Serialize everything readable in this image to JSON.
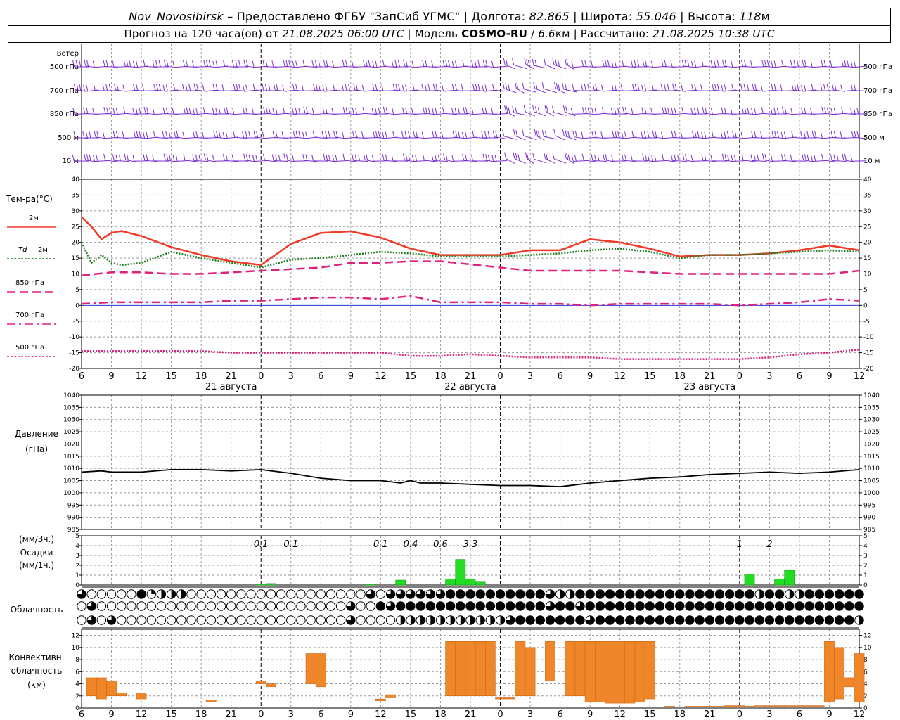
{
  "header": {
    "station": "Nov_Novosibirsk",
    "dash": "–",
    "provider": "Предоставлено ФГБУ \"ЗапСиб УГМС\"",
    "lon_label": "Долгота:",
    "lon": "82.865",
    "lat_label": "Широта:",
    "lat": "55.046",
    "alt_label": "Высота:",
    "alt": "118",
    "alt_unit": "м",
    "forecast_prefix": "Прогноз на 120 часа(ов) от",
    "forecast_start": "21.08.2025 06:00 UTC",
    "model_label": "Модель",
    "model": "COSMO-RU",
    "resolution": "6.6",
    "res_unit": "км",
    "calc_label": "Рассчитано:",
    "calc_time": "21.08.2025 10:38 UTC",
    "sep": "|"
  },
  "wind": {
    "title": "Ветер",
    "levels": [
      "500 гПа",
      "700 гПа",
      "850 гПа",
      "500 м",
      "10  м"
    ],
    "color": "#7b2fd0"
  },
  "temperature": {
    "title": "Тем-ра(°C)",
    "legend": [
      {
        "label": "2м",
        "color": "#f03a2a",
        "style": "solid"
      },
      {
        "label": "Td",
        "label2": "2м",
        "color": "#1e7d1e",
        "style": "dotted"
      },
      {
        "label": "850 гПа",
        "color": "#e0207a",
        "style": "dashed"
      },
      {
        "label": "700 гПа",
        "color": "#e0207a",
        "style": "dashdot"
      },
      {
        "label": "500 гПа",
        "color": "#e0207a",
        "style": "dotted"
      }
    ]
  },
  "pressure": {
    "title": "Давление",
    "unit": "(гПа)"
  },
  "precip": {
    "unit3": "(мм/3ч.)",
    "title": "Осадки",
    "unit1": "(мм/1ч.)",
    "color": "#22dd22",
    "annotations": [
      {
        "h": 24,
        "text": "0.1"
      },
      {
        "h": 27,
        "text": "0.1"
      },
      {
        "h": 36,
        "text": "0.1"
      },
      {
        "h": 39,
        "text": "0.4"
      },
      {
        "h": 42,
        "text": "0.6"
      },
      {
        "h": 45,
        "text": "3.3"
      },
      {
        "h": 72,
        "text": "1"
      },
      {
        "h": 75,
        "text": "2"
      }
    ]
  },
  "cloud": {
    "title": "Облачность"
  },
  "conv": {
    "title1": "Конвективн.",
    "title2": "облачность",
    "unit": "(км)",
    "color": "#f0862a"
  },
  "axis": {
    "day_labels": [
      {
        "h": 6,
        "text": "21 августа"
      },
      {
        "h": 30,
        "text": "22 августа"
      },
      {
        "h": 54,
        "text": "23 августа"
      }
    ]
  },
  "chart_data": {
    "type": "line",
    "x_unit": "hours since 21.08.2025 00 UTC",
    "x_range": [
      6,
      84
    ],
    "x_ticks": [
      6,
      9,
      12,
      15,
      18,
      21,
      0,
      3,
      6,
      9,
      12,
      15,
      18,
      21,
      0,
      3,
      6,
      9,
      12,
      15,
      18,
      21,
      0,
      3,
      6,
      9,
      12
    ],
    "midnight_hours": [
      24,
      48,
      72
    ],
    "temperature": {
      "ylim": [
        -20,
        40
      ],
      "yticks": [
        -20,
        -15,
        -10,
        -5,
        0,
        5,
        10,
        15,
        20,
        25,
        30,
        35,
        40
      ],
      "series": [
        {
          "name": "2м",
          "x": [
            6,
            7,
            8,
            9,
            10,
            12,
            15,
            18,
            21,
            24,
            27,
            30,
            33,
            36,
            39,
            42,
            45,
            48,
            51,
            54,
            57,
            60,
            63,
            66,
            69,
            72,
            75,
            78,
            81,
            84
          ],
          "values": [
            28,
            25,
            21,
            23,
            23.6,
            22,
            18.5,
            16,
            14,
            12.8,
            19.5,
            23,
            23.5,
            21.5,
            18,
            16,
            16,
            16,
            17.5,
            17.5,
            21,
            20,
            18,
            15.5,
            16,
            16,
            16.5,
            17.5,
            19,
            17.5
          ]
        },
        {
          "name": "Td 2м",
          "x": [
            6,
            7,
            8,
            9,
            10,
            12,
            15,
            18,
            21,
            24,
            27,
            30,
            33,
            36,
            39,
            42,
            45,
            48,
            51,
            54,
            57,
            60,
            63,
            66,
            69,
            72,
            75,
            78,
            81,
            84
          ],
          "values": [
            20,
            13.5,
            16,
            13.5,
            12.8,
            13.5,
            17,
            15,
            13.5,
            12,
            14.5,
            15,
            16,
            17,
            16.5,
            15.5,
            15.5,
            15.5,
            16,
            16.5,
            17.5,
            18,
            17,
            15,
            16,
            16,
            16.5,
            17,
            17.5,
            17
          ]
        },
        {
          "name": "850 гПа",
          "x": [
            6,
            9,
            12,
            15,
            18,
            21,
            24,
            27,
            30,
            33,
            36,
            39,
            42,
            45,
            48,
            51,
            54,
            57,
            60,
            63,
            66,
            69,
            72,
            75,
            78,
            81,
            84
          ],
          "values": [
            9.5,
            10.5,
            10.5,
            10,
            10,
            10.5,
            11,
            11.5,
            12,
            13.5,
            13.5,
            14,
            14,
            13,
            12,
            11,
            11,
            11,
            11,
            10.5,
            10,
            10,
            10,
            10,
            10,
            10,
            11
          ]
        },
        {
          "name": "700 гПа",
          "x": [
            6,
            9,
            12,
            15,
            18,
            21,
            24,
            27,
            30,
            33,
            36,
            39,
            42,
            45,
            48,
            51,
            54,
            57,
            60,
            63,
            66,
            69,
            72,
            75,
            78,
            81,
            84
          ],
          "values": [
            0.5,
            1,
            1,
            1,
            1,
            1.5,
            1.5,
            2,
            2.5,
            2.5,
            2,
            3,
            1,
            1,
            1,
            0.5,
            0.5,
            0,
            0.5,
            0.5,
            0.5,
            0.5,
            0,
            0.5,
            1,
            2,
            1.5
          ]
        },
        {
          "name": "500 гПа",
          "x": [
            6,
            9,
            12,
            15,
            18,
            21,
            24,
            27,
            30,
            33,
            36,
            39,
            42,
            45,
            48,
            51,
            54,
            57,
            60,
            63,
            66,
            69,
            72,
            75,
            78,
            81,
            84
          ],
          "values": [
            -14.5,
            -14.5,
            -14.5,
            -14.5,
            -14.5,
            -15,
            -15,
            -15,
            -15,
            -15,
            -15,
            -16,
            -16,
            -15.5,
            -16,
            -16.5,
            -16.5,
            -16.5,
            -17,
            -17,
            -17,
            -17,
            -17,
            -16.5,
            -15.5,
            -15,
            -14
          ]
        }
      ]
    },
    "pressure": {
      "ylim": [
        985,
        1040
      ],
      "yticks": [
        985,
        990,
        995,
        1000,
        1005,
        1010,
        1015,
        1020,
        1025,
        1030,
        1035,
        1040
      ],
      "x": [
        6,
        8,
        9,
        12,
        15,
        18,
        21,
        24,
        27,
        30,
        33,
        36,
        38,
        39,
        40,
        42,
        45,
        48,
        51,
        54,
        57,
        60,
        63,
        66,
        69,
        72,
        75,
        78,
        81,
        84
      ],
      "values": [
        1008.5,
        1009,
        1008.5,
        1008.5,
        1009.5,
        1009.5,
        1009,
        1009.5,
        1008,
        1006,
        1005,
        1005,
        1004,
        1005,
        1004,
        1004,
        1003.5,
        1003,
        1003,
        1002.5,
        1004,
        1005,
        1006,
        1006.5,
        1007.5,
        1008,
        1008.5,
        1008,
        1008.5,
        1009.5
      ]
    },
    "precipitation": {
      "ylim": [
        0,
        5
      ],
      "yticks": [
        0,
        1,
        2,
        3,
        4,
        5
      ],
      "x": [
        24,
        25,
        35,
        38,
        43,
        44,
        45,
        46,
        73,
        76,
        77
      ],
      "values": [
        0.1,
        0.15,
        0.1,
        0.5,
        0.6,
        2.6,
        0.6,
        0.3,
        1.1,
        0.6,
        1.5
      ]
    },
    "cloudiness": {
      "rows": [
        "верхний ярус",
        "средний ярус",
        "нижний ярус"
      ],
      "scale": "0=ясно, 1=четверть, 2=половина, 3=три четверти, 4=сплошная",
      "hours": [
        6,
        7,
        8,
        9,
        10,
        11,
        12,
        13,
        14,
        15,
        16,
        17,
        18,
        19,
        20,
        21,
        22,
        23,
        24,
        25,
        26,
        27,
        28,
        29,
        30,
        31,
        32,
        33,
        34,
        35,
        36,
        37,
        38,
        39,
        40,
        41,
        42,
        43,
        44,
        45,
        46,
        47,
        48,
        49,
        50,
        51,
        52,
        53,
        54,
        55,
        56,
        57,
        58,
        59,
        60,
        61,
        62,
        63,
        64,
        65,
        66,
        67,
        68,
        69,
        70,
        71,
        72,
        73,
        74,
        75,
        76,
        77,
        78,
        79,
        80,
        81,
        82,
        83,
        84
      ],
      "top": [
        3,
        0,
        0,
        0,
        0,
        0,
        4,
        1,
        2,
        2,
        2,
        0,
        0,
        0,
        0,
        0,
        0,
        0,
        0,
        0,
        0,
        0,
        0,
        0,
        0,
        0,
        0,
        0,
        0,
        3,
        0,
        3,
        3,
        3,
        3,
        3,
        3,
        4,
        4,
        4,
        4,
        4,
        4,
        4,
        4,
        4,
        4,
        3,
        2,
        2,
        4,
        4,
        4,
        4,
        4,
        4,
        4,
        4,
        4,
        4,
        4,
        4,
        4,
        4,
        4,
        4,
        4,
        4,
        2,
        4,
        4,
        2,
        2,
        4,
        4,
        4,
        4,
        4,
        4
      ],
      "middle": [
        0,
        3,
        0,
        0,
        0,
        0,
        0,
        0,
        0,
        0,
        0,
        0,
        0,
        0,
        0,
        0,
        0,
        0,
        0,
        0,
        0,
        0,
        0,
        0,
        0,
        0,
        0,
        3,
        0,
        0,
        4,
        3,
        4,
        4,
        4,
        4,
        4,
        4,
        4,
        4,
        4,
        4,
        4,
        4,
        4,
        4,
        4,
        3,
        4,
        4,
        3,
        4,
        4,
        4,
        4,
        4,
        4,
        4,
        4,
        4,
        4,
        4,
        4,
        4,
        4,
        4,
        4,
        4,
        4,
        4,
        4,
        4,
        4,
        4,
        4,
        4,
        4,
        4,
        4
      ],
      "bottom": [
        0,
        3,
        0,
        3,
        0,
        0,
        0,
        0,
        0,
        0,
        0,
        0,
        0,
        0,
        0,
        0,
        0,
        0,
        0,
        0,
        0,
        0,
        0,
        0,
        0,
        0,
        0,
        3,
        0,
        0,
        0,
        0,
        2,
        2,
        2,
        2,
        2,
        2,
        2,
        2,
        2,
        2,
        2,
        3,
        4,
        4,
        4,
        4,
        4,
        4,
        4,
        3,
        4,
        4,
        4,
        4,
        4,
        4,
        4,
        4,
        4,
        4,
        4,
        4,
        4,
        4,
        4,
        4,
        4,
        4,
        4,
        4,
        4,
        4,
        4,
        4,
        4,
        4,
        2
      ]
    },
    "convective_cloud": {
      "ylim": [
        0,
        13
      ],
      "yticks": [
        0,
        2,
        4,
        6,
        8,
        10,
        12
      ],
      "x": [
        7,
        8,
        9,
        10,
        12,
        19,
        24,
        25,
        29,
        30,
        36,
        37,
        43,
        44,
        45,
        46,
        47,
        48,
        49,
        50,
        51,
        53,
        55,
        56,
        57,
        58,
        59,
        60,
        61,
        62,
        63,
        65,
        67,
        68,
        69,
        70,
        71,
        72,
        73,
        74,
        75,
        76,
        77,
        78,
        79,
        80,
        81,
        82,
        83,
        84
      ],
      "base": [
        2,
        1.5,
        2,
        2,
        1.5,
        1,
        4,
        3.5,
        4,
        3.5,
        1.2,
        1.8,
        2,
        2,
        2,
        2,
        2,
        1.5,
        1.5,
        2,
        2,
        4.5,
        2,
        2,
        1,
        1,
        0.8,
        0.8,
        0.8,
        1,
        1.5,
        0.2,
        0.2,
        0.2,
        0.2,
        0.2,
        0.2,
        0.3,
        0.2,
        0.3,
        0.3,
        0.3,
        0.3,
        0.3,
        0.3,
        0.3,
        1,
        1.5,
        3.5,
        1
      ],
      "top": [
        5,
        5,
        4.5,
        2.5,
        2.5,
        1.3,
        4.5,
        4,
        9,
        9,
        1.5,
        2.2,
        11,
        11,
        11,
        11,
        11,
        1.8,
        1.8,
        11,
        10,
        11,
        11,
        11,
        11,
        11,
        11,
        11,
        11,
        11,
        11,
        0.3,
        0.3,
        0.3,
        0.3,
        0.3,
        0.4,
        0.4,
        0.3,
        0.4,
        0.4,
        0.4,
        0.4,
        0.4,
        0.4,
        0.4,
        11,
        10,
        5,
        9
      ]
    }
  }
}
